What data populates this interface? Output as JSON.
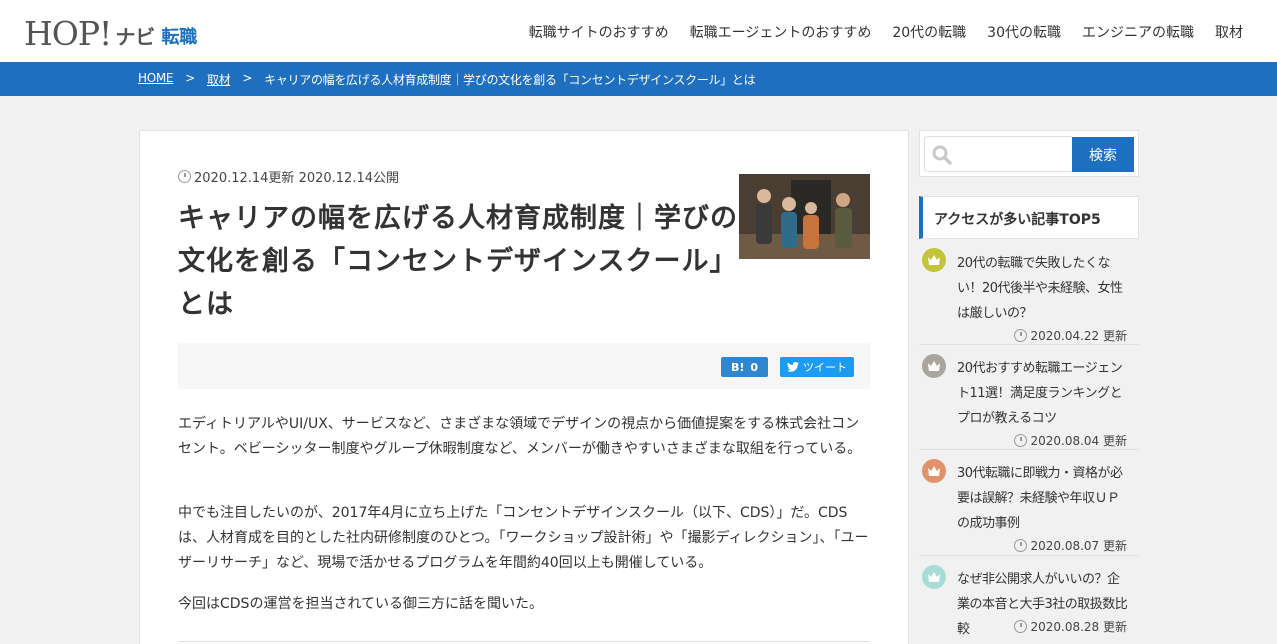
{
  "header": {
    "logo_hop": "HOP!",
    "logo_navi": "ナビ",
    "logo_job": "転職",
    "nav": [
      "転職サイトのおすすめ",
      "転職エージェントのおすすめ",
      "20代の転職",
      "30代の転職",
      "エンジニアの転職",
      "取材"
    ]
  },
  "breadcrumb": {
    "home": "HOME",
    "sep": ">",
    "category": "取材",
    "current": "キャリアの幅を広げる人材育成制度｜学びの文化を創る「コンセントデザインスクール」とは"
  },
  "article": {
    "dates": "2020.12.14更新 2020.12.14公開",
    "title": "キャリアの幅を広げる人材育成制度｜学びの文化を創る「コンセントデザインスクール」とは",
    "hatena_label": "B!",
    "hatena_count": "0",
    "tweet_label": "ツイート",
    "paragraphs": [
      "エディトリアルやUI/UX、サービスなど、さまざまな領域でデザインの視点から価値提案をする株式会社コンセント。ベビーシッター制度やグループ休暇制度など、メンバーが働きやすいさまざまな取組を行っている。",
      "中でも注目したいのが、2017年4月に立ち上げた「コンセントデザインスクール（以下、CDS）」だ。CDSは、人材育成を目的とした社内研修制度のひとつ。「ワークショップ設計術」や「撮影ディレクション」、「ユーザーリサーチ」など、現場で活かせるプログラムを年間約40回以上も開催している。",
      "今回はCDSの運営を担当されている御三方に話を聞いた。"
    ]
  },
  "sidebar": {
    "search_placeholder": "",
    "search_button": "検索",
    "widget_title": "アクセスが多い記事TOP5",
    "ranking": [
      {
        "title": "20代の転職で失敗したくない！20代後半や未経験、女性は厳しいの？",
        "date": "2020.04.22 更新",
        "color": "#c4c43a"
      },
      {
        "title": "20代おすすめ転職エージェント11選！満足度ランキングとプロが教えるコツ",
        "date": "2020.08.04 更新",
        "color": "#aaa69d"
      },
      {
        "title": "30代転職に即戦力・資格が必要は誤解？未経験や年収ＵＰの成功事例",
        "date": "2020.08.07 更新",
        "color": "#e0936a"
      },
      {
        "title": "なぜ非公開求人がいいの？企業の本音と大手3社の取扱数比較",
        "date": "2020.08.28 更新",
        "color": "#a8dcd6"
      }
    ]
  },
  "colors": {
    "brand_blue": "#1f6fc1",
    "hatena_blue": "#2f86cf",
    "twitter_blue": "#1d9bf0"
  }
}
